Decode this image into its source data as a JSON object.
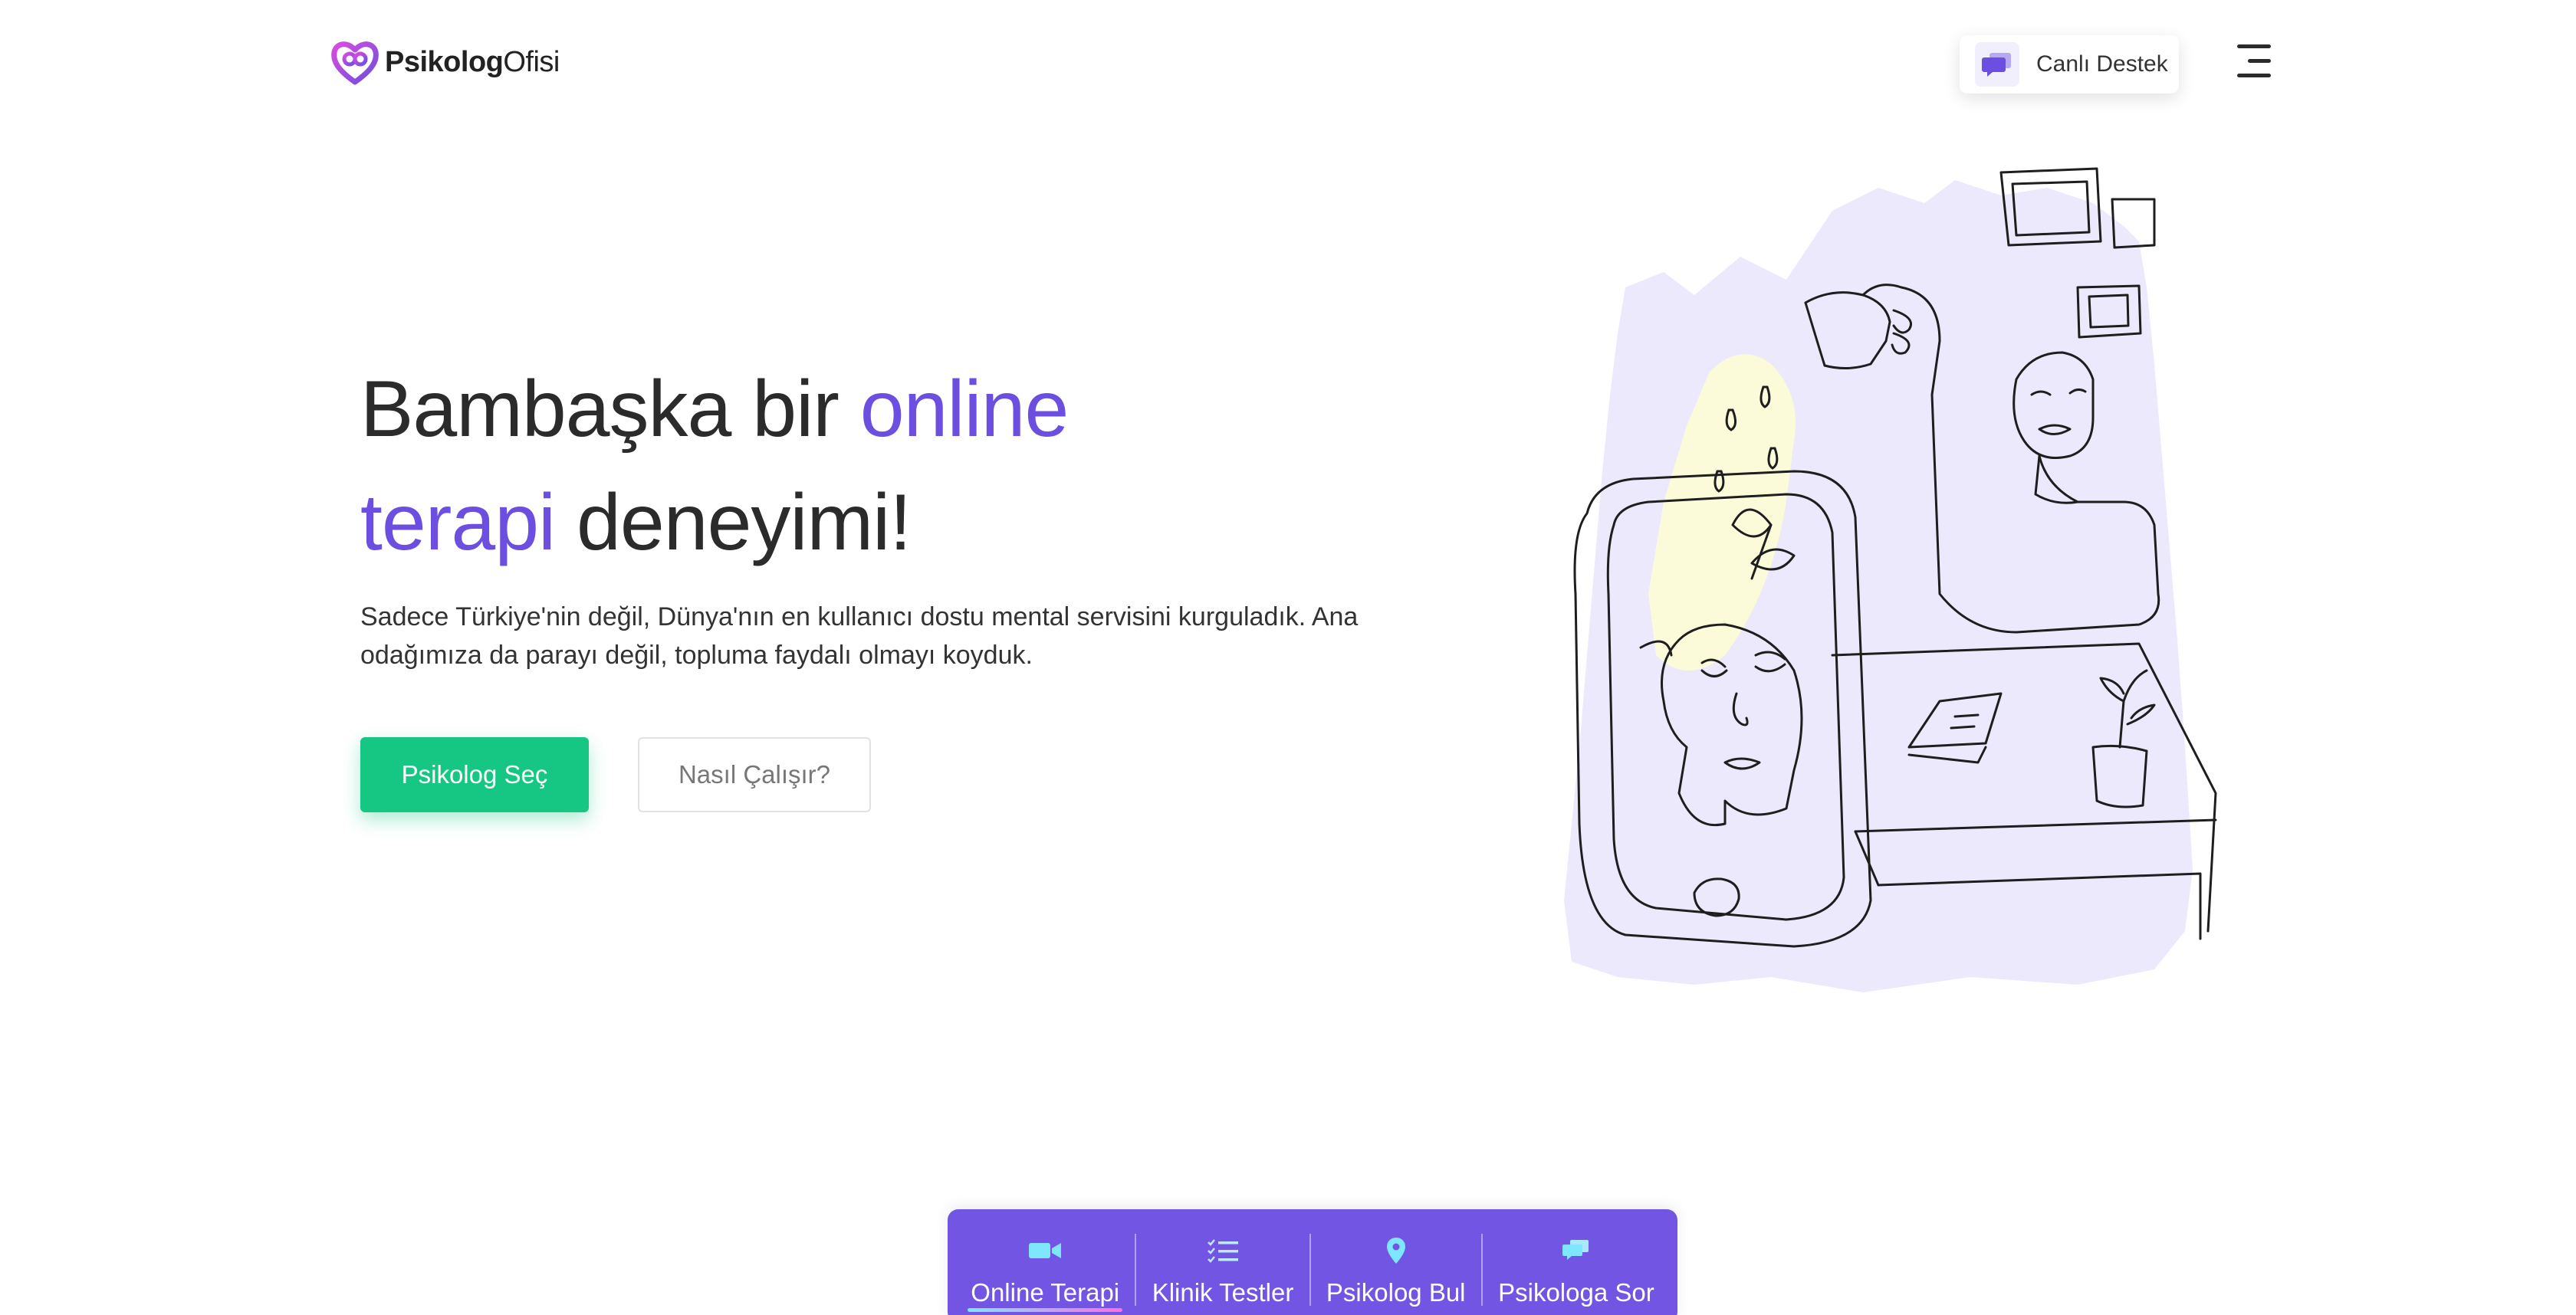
{
  "header": {
    "logo_brand_bold": "Psikolog",
    "logo_brand_light": "Ofisi",
    "support_label": "Canlı Destek",
    "support_icon": "chat-bubbles-icon",
    "menu_icon": "hamburger-menu-icon"
  },
  "hero": {
    "title_part1": "Bambaşka bir ",
    "title_accent1": "online",
    "title_accent2": "terapi",
    "title_part2": " deneyimi!",
    "description": "Sadece Türkiye'nin değil, Dünya'nın en kullanıcı dostu mental servisini kurguladık. Ana odağımıza da parayı değil, topluma faydalı olmayı koyduk.",
    "primary_button": "Psikolog Seç",
    "secondary_button": "Nasıl Çalışır?"
  },
  "bottom_nav": {
    "items": [
      {
        "label": "Online Terapi",
        "icon": "video-camera-icon",
        "active": true
      },
      {
        "label": "Klinik Testler",
        "icon": "checklist-icon",
        "active": false
      },
      {
        "label": "Psikolog Bul",
        "icon": "location-pin-icon",
        "active": false
      },
      {
        "label": "Psikologa Sor",
        "icon": "chat-icon",
        "active": false
      }
    ]
  },
  "colors": {
    "accent": "#6c4fe0",
    "primary_button": "#16c784",
    "nav_background": "#7255e3",
    "illustration_background": "#ece9fd",
    "illustration_highlight": "#fbfbd9"
  }
}
